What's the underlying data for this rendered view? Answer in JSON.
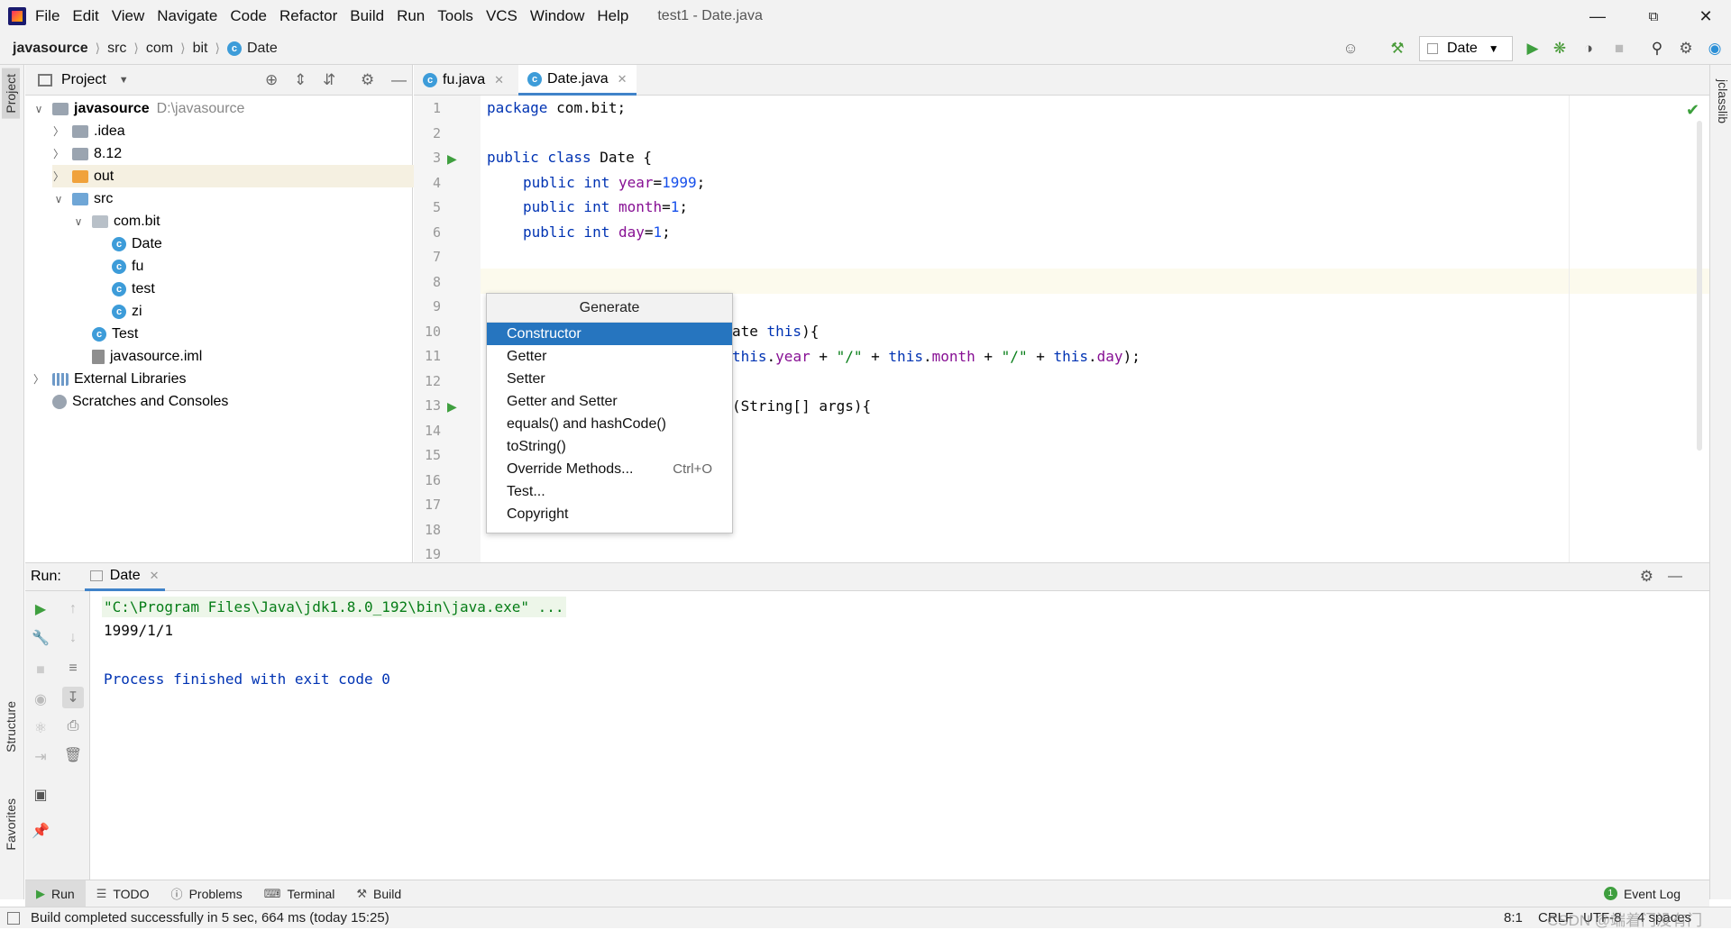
{
  "window": {
    "title": "test1 - Date.java"
  },
  "menu": [
    "File",
    "Edit",
    "View",
    "Navigate",
    "Code",
    "Refactor",
    "Build",
    "Run",
    "Tools",
    "VCS",
    "Window",
    "Help"
  ],
  "breadcrumb": [
    "javasource",
    "src",
    "com",
    "bit",
    "Date"
  ],
  "run_config": "Date",
  "project_panel": {
    "title": "Project",
    "tree": [
      {
        "label": "javasource",
        "extra": "D:\\javasource",
        "depth": 0,
        "type": "root"
      },
      {
        "label": ".idea",
        "depth": 1,
        "type": "folder"
      },
      {
        "label": "8.12",
        "depth": 1,
        "type": "folder"
      },
      {
        "label": "out",
        "depth": 1,
        "type": "folder-orange"
      },
      {
        "label": "src",
        "depth": 1,
        "type": "folder-blue"
      },
      {
        "label": "com.bit",
        "depth": 2,
        "type": "package"
      },
      {
        "label": "Date",
        "depth": 3,
        "type": "class"
      },
      {
        "label": "fu",
        "depth": 3,
        "type": "class"
      },
      {
        "label": "test",
        "depth": 3,
        "type": "class"
      },
      {
        "label": "zi",
        "depth": 3,
        "type": "class"
      },
      {
        "label": "Test",
        "depth": 2,
        "type": "class"
      },
      {
        "label": "javasource.iml",
        "depth": 2,
        "type": "iml"
      },
      {
        "label": "External Libraries",
        "depth": 0,
        "type": "lib"
      },
      {
        "label": "Scratches and Consoles",
        "depth": 0,
        "type": "scratch"
      }
    ]
  },
  "editor_tabs": [
    {
      "label": "fu.java"
    },
    {
      "label": "Date.java"
    }
  ],
  "code_lines": [
    "1",
    "2",
    "3",
    "4",
    "5",
    "6",
    "7",
    "8",
    "9",
    "10",
    "11",
    "12",
    "13",
    "14",
    "15",
    "16",
    "17",
    "18",
    "19"
  ],
  "code": {
    "l1_kw": "package",
    "l1_rest": " com.bit;",
    "l3_kw": "public class",
    "l3_rest": " Date {",
    "l4": "year",
    "l4_val": "1999",
    "l5": "month",
    "l5_val": "1",
    "l6": "day",
    "l6_val": "1",
    "decl_kw": "public int",
    "l10_tail_a": "ate ",
    "l10_tail_kw": "this",
    "l10_tail_b": "){",
    "l11_this": "this",
    "l11_year": "year",
    "l11_sep": "\"/\"",
    "l11_month": "month",
    "l11_day": "day",
    "l13_tail": "(String[] args){"
  },
  "generate_popup": {
    "title": "Generate",
    "items": [
      {
        "label": "Constructor",
        "shortcut": ""
      },
      {
        "label": "Getter",
        "shortcut": ""
      },
      {
        "label": "Setter",
        "shortcut": ""
      },
      {
        "label": "Getter and Setter",
        "shortcut": ""
      },
      {
        "label": "equals() and hashCode()",
        "shortcut": ""
      },
      {
        "label": "toString()",
        "shortcut": ""
      },
      {
        "label": "Override Methods...",
        "shortcut": "Ctrl+O"
      },
      {
        "label": "Test...",
        "shortcut": ""
      },
      {
        "label": "Copyright",
        "shortcut": ""
      }
    ]
  },
  "run_panel": {
    "label": "Run:",
    "tab": "Date",
    "console": [
      "\"C:\\Program Files\\Java\\jdk1.8.0_192\\bin\\java.exe\" ...",
      "1999/1/1",
      "Process finished with exit code 0"
    ]
  },
  "tool_windows": [
    "Run",
    "TODO",
    "Problems",
    "Terminal",
    "Build"
  ],
  "event_log": "Event Log",
  "side_tabs": {
    "project": "Project",
    "structure": "Structure",
    "favorites": "Favorites",
    "jclasslib": "jclasslib"
  },
  "status": {
    "message": "Build completed successfully in 5 sec, 664 ms (today 15:25)",
    "position": "8:1",
    "line_sep": "CRLF",
    "encoding": "UTF-8",
    "indent": "4 spaces",
    "watermark": "CSDN @端着门没有门"
  }
}
